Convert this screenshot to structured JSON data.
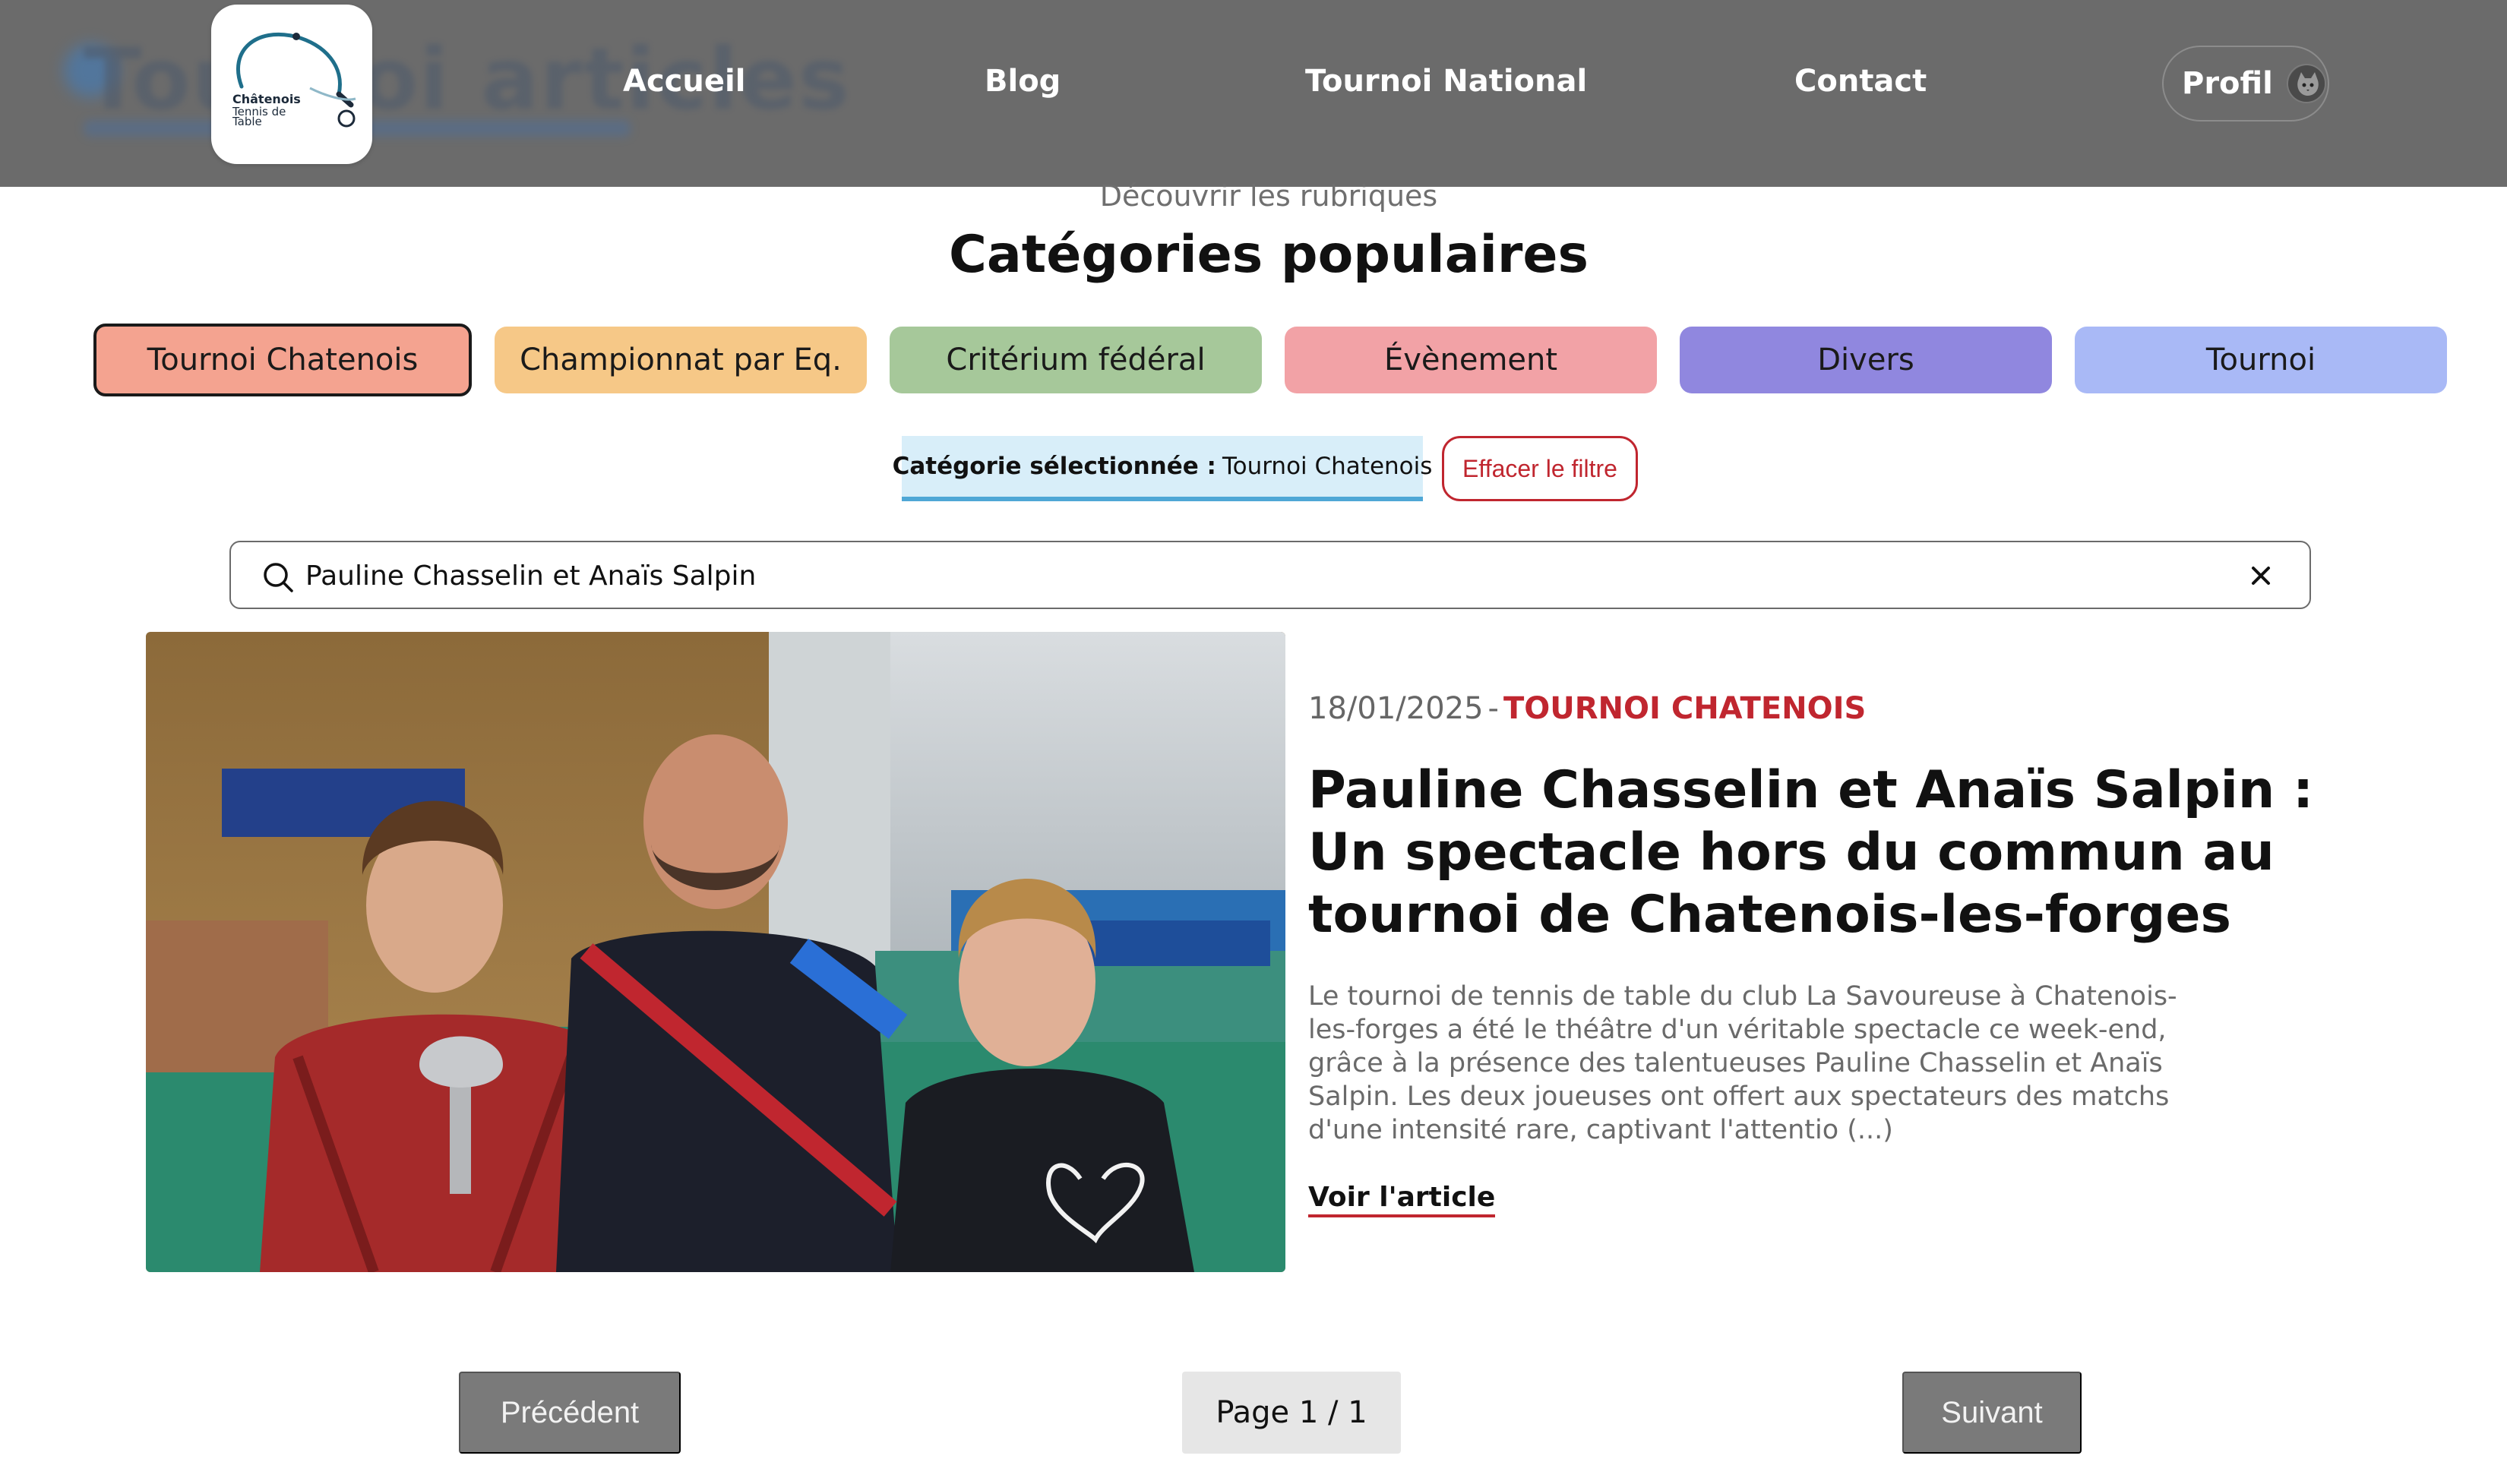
{
  "header": {
    "ghost_title": "Tournoi articles",
    "logo": {
      "brand": "Châtenois",
      "line1": "Tennis de",
      "line2": "Table"
    },
    "nav": [
      {
        "label": "Accueil"
      },
      {
        "label": "Blog"
      },
      {
        "label": "Tournoi National"
      },
      {
        "label": "Contact"
      }
    ],
    "profile_label": "Profil",
    "bg_color": "#6b6b6b"
  },
  "section": {
    "kicker": "Découvrir les rubriques",
    "title": "Catégories populaires"
  },
  "categories": [
    {
      "label": "Tournoi Chatenois",
      "color": "#f4a390",
      "selected": true
    },
    {
      "label": "Championnat par Eq.",
      "color": "#f6c887"
    },
    {
      "label": "Critérium fédéral",
      "color": "#a6c89a"
    },
    {
      "label": "Évènement",
      "color": "#f2a2a6"
    },
    {
      "label": "Divers",
      "color": "#9087df"
    },
    {
      "label": "Tournoi",
      "color": "#a9b9f6"
    }
  ],
  "filter": {
    "label": "Catégorie sélectionnée :",
    "value": "Tournoi Chatenois",
    "clear_label": "Effacer le filtre"
  },
  "search": {
    "value": "Pauline Chasselin et Anaïs Salpin"
  },
  "article": {
    "date": "18/01/2025",
    "separator": "-",
    "category": "TOURNOI CHATENOIS",
    "title": "Pauline Chasselin et Anaïs Salpin : Un spectacle hors du commun au tournoi de Chatenois-les-forges",
    "excerpt": "Le tournoi de tennis de table du club La Savoureuse à Chatenois-les-forges a été le théâtre d'un véritable spectacle ce week-end, grâce à la présence des talentueuses Pauline Chasselin et Anaïs Salpin. Les deux joueuses ont offert aux spectateurs des matchs d'une intensité rare, captivant l'attentio (...)",
    "read_more": "Voir l'article"
  },
  "pagination": {
    "prev": "Précédent",
    "info": "Page 1 / 1",
    "next": "Suivant"
  },
  "colors": {
    "accent_red": "#c0262f",
    "filter_blue": "#4fa7d6"
  }
}
